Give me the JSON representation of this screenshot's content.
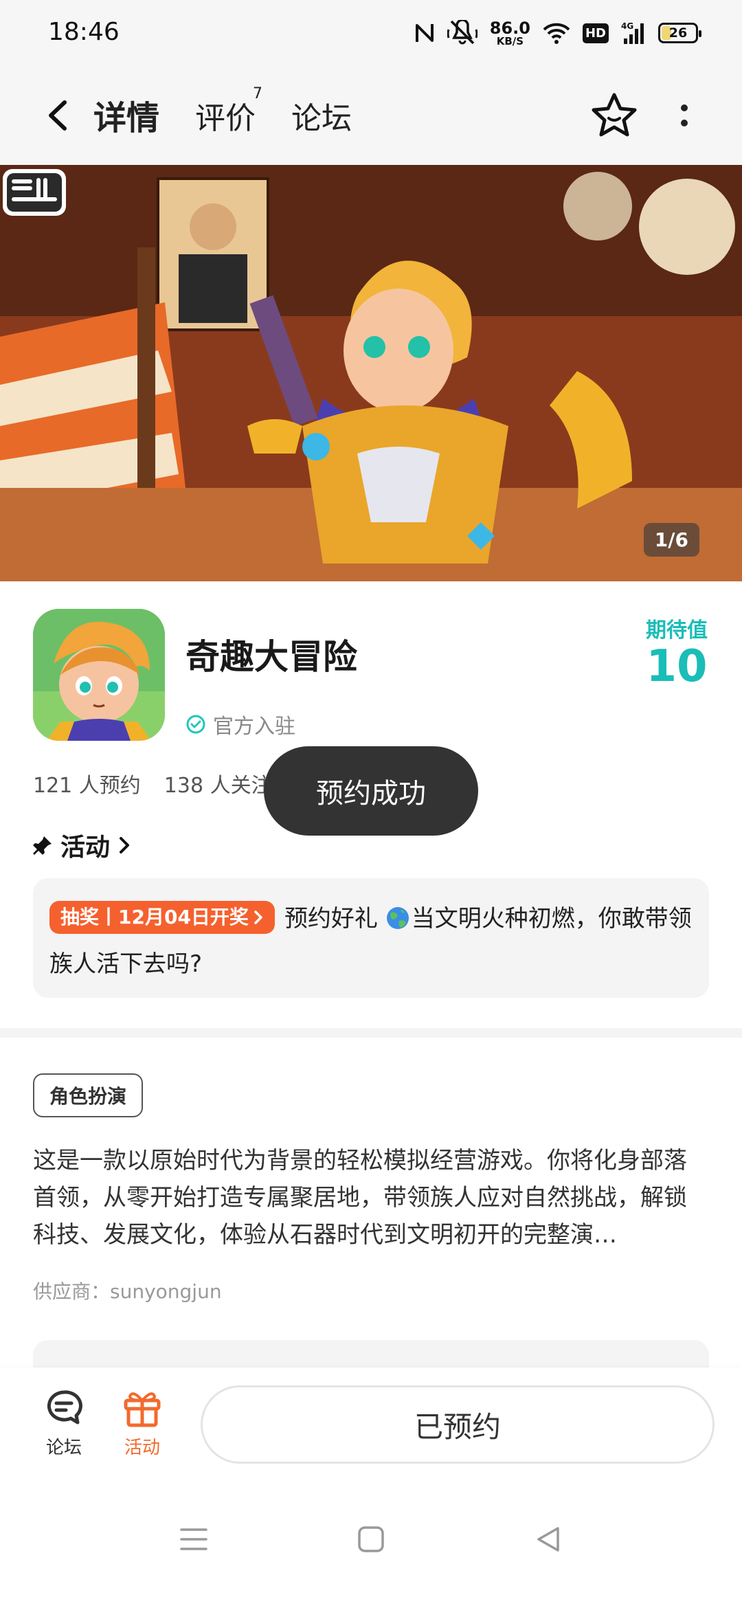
{
  "status_bar": {
    "time": "18:46",
    "net_speed_value": "86.0",
    "net_speed_unit": "KB/S",
    "hd_label": "HD",
    "network_label": "4G",
    "battery_level": "26"
  },
  "nav": {
    "tabs": [
      {
        "label": "详情",
        "active": true
      },
      {
        "label": "评价",
        "badge": "7"
      },
      {
        "label": "论坛"
      }
    ]
  },
  "banner": {
    "counter": "1/6"
  },
  "game": {
    "title": "奇趣大冒险",
    "official_label": "官方入驻",
    "expect_label": "期待值",
    "expect_value": "10",
    "reservations": "121 人预约",
    "followers": "138 人关注"
  },
  "activity": {
    "header": "活动",
    "badge": "抽奖丨12月04日开奖",
    "title_prefix": "预约好礼",
    "title_rest": "当文明火种初燃，你敢带领族人活下去吗?"
  },
  "description": {
    "genre_tag": "角色扮演",
    "text": "这是一款以原始时代为背景的轻松模拟经营游戏。你将化身部落首领，从零开始打造专属聚居地，带领族人应对自然挑战，解锁科技、发展文化，体验从石器时代到文明初开的完整演…",
    "supplier": "供应商：sunyongjun"
  },
  "toast": "预约成功",
  "action_bar": {
    "forum_label": "论坛",
    "activity_label": "活动",
    "reserve_button": "已预约"
  },
  "colors": {
    "accent_teal": "#1fc6c0",
    "accent_orange": "#f5612e",
    "toast_bg": "#333333"
  }
}
